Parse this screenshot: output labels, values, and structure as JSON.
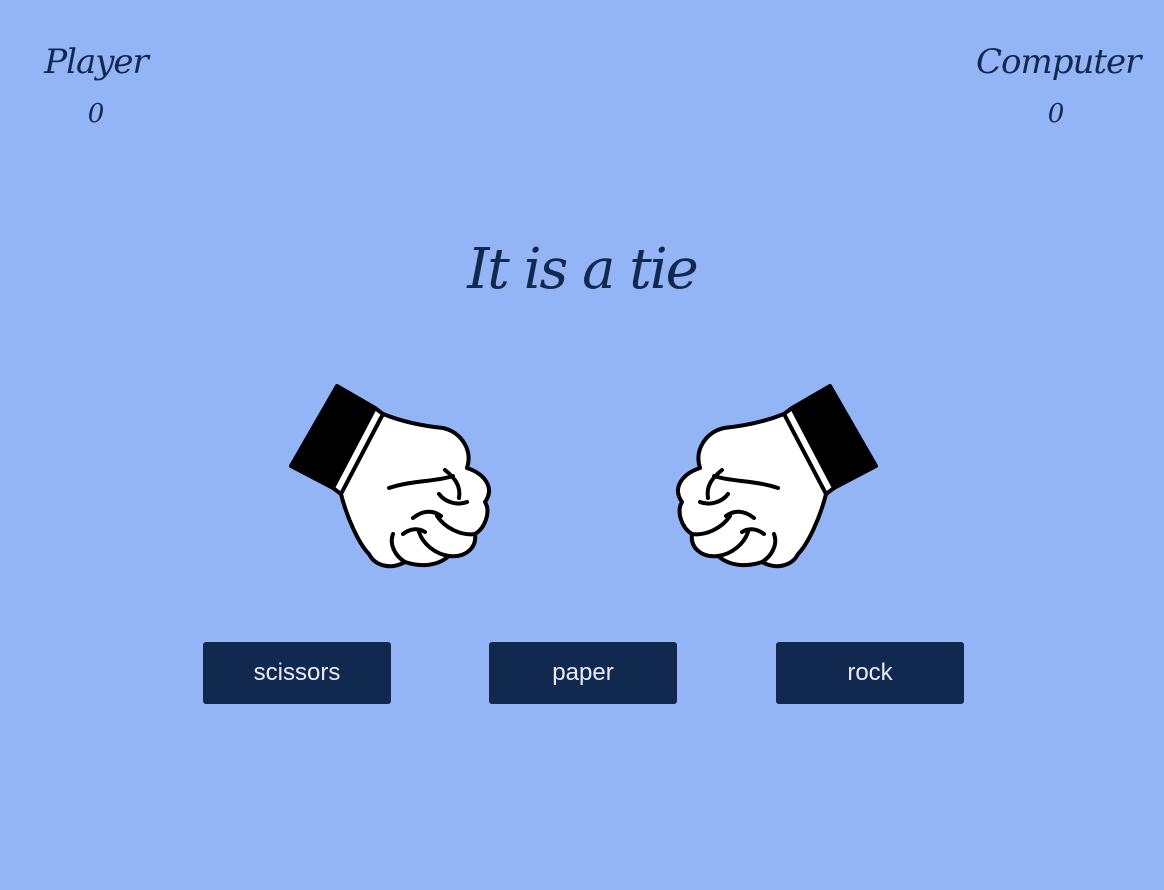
{
  "player": {
    "label": "Player",
    "score": "0"
  },
  "computer": {
    "label": "Computer",
    "score": "0"
  },
  "result": "It is a tie",
  "hands": {
    "player": "fist-icon",
    "computer": "fist-icon"
  },
  "choices": [
    "scissors",
    "paper",
    "rock"
  ],
  "colors": {
    "background": "#93b4f5",
    "text": "#12294f",
    "button": "#12294f",
    "button_text": "#e6ecf8"
  }
}
